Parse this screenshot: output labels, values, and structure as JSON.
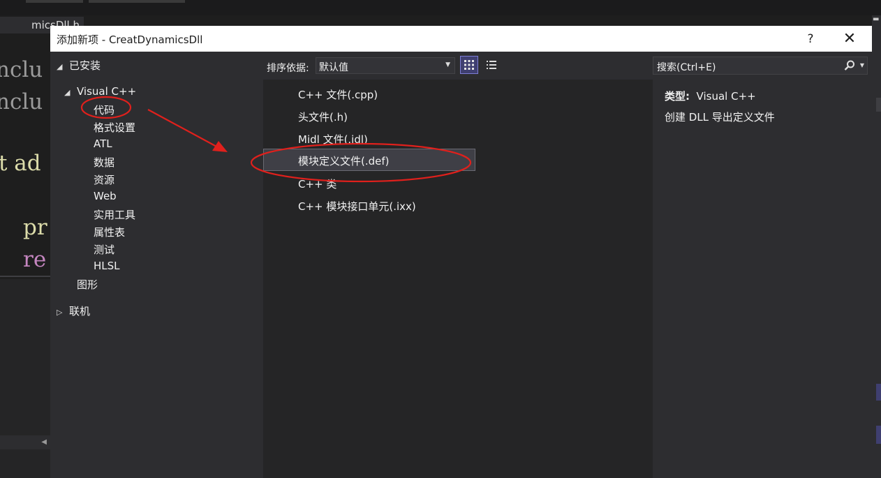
{
  "editor_background": {
    "tab_title": "micsDll.h",
    "code_lines": [
      {
        "text": "nclu",
        "color": "#9b9b9b"
      },
      {
        "text": "nclu",
        "color": "#9b9b9b"
      },
      {
        "text": "t ad",
        "color": "#dcdcaa",
        "prefix_color": "#569cd6"
      },
      {
        "text": "pr",
        "color": "#dcdcaa"
      },
      {
        "text": "re",
        "color": "#c586c0"
      }
    ]
  },
  "dialog": {
    "title": "添加新项 - CreatDynamicsDll",
    "help_label": "?",
    "close_label": "✕",
    "tree": {
      "installed": "已安装",
      "visual_cpp": "Visual C++",
      "children": [
        "代码",
        "格式设置",
        "ATL",
        "数据",
        "资源",
        "Web",
        "实用工具",
        "属性表",
        "测试",
        "HLSL"
      ],
      "graphics": "图形",
      "online": "联机"
    },
    "sort": {
      "label": "排序依据:",
      "value": "默认值"
    },
    "templates": [
      "C++ 文件(.cpp)",
      "头文件(.h)",
      "Midl 文件(.idl)",
      "模块定义文件(.def)",
      "C++ 类",
      "C++ 模块接口单元(.ixx)"
    ],
    "selected_template": 3,
    "search_placeholder": "搜索(Ctrl+E)",
    "details": {
      "type_label": "类型:",
      "type_value": "Visual C++",
      "description": "创建 DLL 导出定义文件"
    }
  },
  "colors": {
    "dialog_bg": "#2d2d30",
    "list_bg": "#252526",
    "annotation_red": "#e0201c",
    "accent": "#7d7dd6"
  }
}
